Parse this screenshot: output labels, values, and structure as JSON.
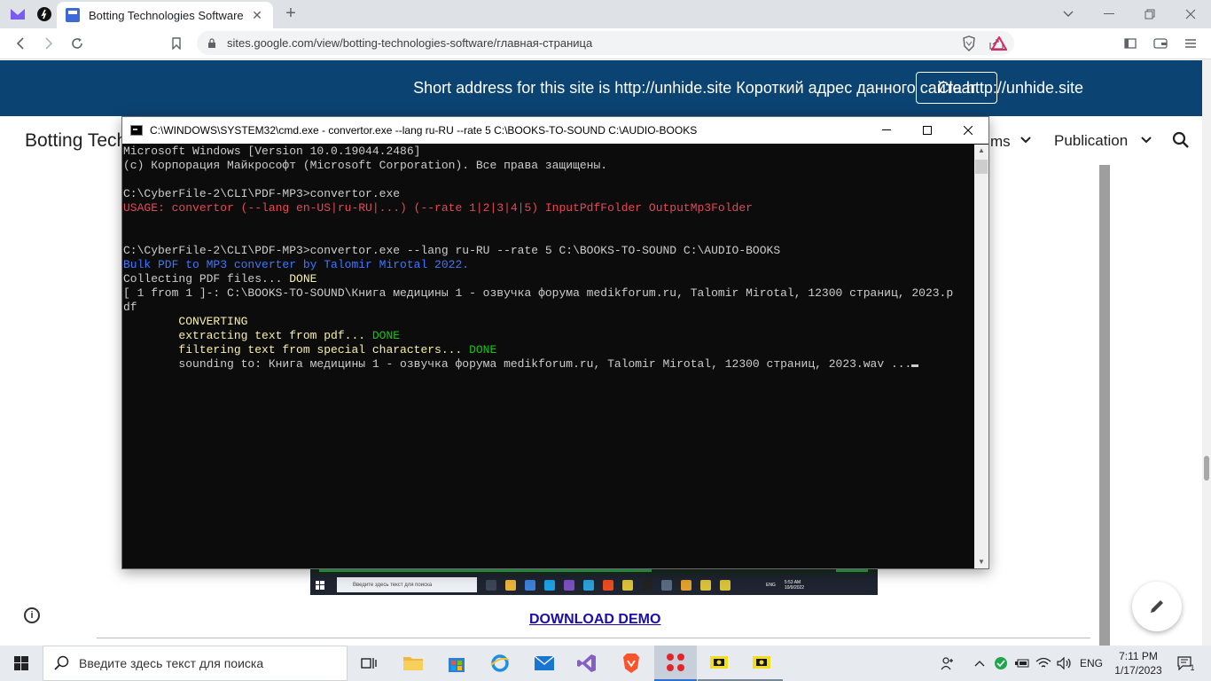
{
  "browser": {
    "tab_title": "Botting Technologies Software",
    "tab_close": "✕",
    "new_tab": "+",
    "url": "sites.google.com/view/botting-technologies-software/главная-страница"
  },
  "banner": {
    "text": "Short address for this site is http://unhide.site Короткий адрес данного сайта http://unhide.site",
    "clear_label": "Clear"
  },
  "site": {
    "title_partial": "Botting Technc",
    "nav_partial": "ms",
    "nav_publication": "Publication",
    "download_demo": "DOWNLOAD DEMO"
  },
  "cmd": {
    "title": "C:\\WINDOWS\\SYSTEM32\\cmd.exe - convertor.exe  --lang ru-RU --rate 5 C:\\BOOKS-TO-SOUND C:\\AUDIO-BOOKS",
    "lines": {
      "l1": "Microsoft Windows [Version 10.0.19044.2486]",
      "l2": "(c) Корпорация Майкрософт (Microsoft Corporation). Все права защищены.",
      "l3": "C:\\CyberFile-2\\CLI\\PDF-MP3>convertor.exe",
      "l4": "USAGE: convertor (--lang en-US|ru-RU|...) (--rate 1|2|3|4|5) InputPdfFolder OutputMp3Folder",
      "l5": "C:\\CyberFile-2\\CLI\\PDF-MP3>convertor.exe --lang ru-RU --rate 5 C:\\BOOKS-TO-SOUND C:\\AUDIO-BOOKS",
      "l6": "Bulk PDF to MP3 converter by Talomir Mirotal 2022.",
      "l7a": "Collecting PDF files... ",
      "l7b": "DONE",
      "l8": "[ 1 from 1 ]-: C:\\BOOKS-TO-SOUND\\Книга медицины 1 - озвучка форума medikforum.ru, Talomir Mirotal, 12300 страниц, 2023.p",
      "l9": "df",
      "l10": "        CONVERTING",
      "l11a": "        extracting text from pdf... ",
      "l11b": "DONE",
      "l12a": "        filtering text from special characters... ",
      "l12b": "DONE",
      "l13": "        sounding to: Книга медицины 1 - озвучка форума medikforum.ru, Talomir Mirotal, 12300 страниц, 2023.wav ..."
    }
  },
  "mini_taskbar": {
    "search_placeholder": "Введите здесь текст для поиска",
    "lang": "ENG",
    "time": "5:53 AM",
    "date": "10/9/2022"
  },
  "taskbar": {
    "search_placeholder": "Введите здесь текст для поиска",
    "lang": "ENG",
    "time": "7:11 PM",
    "date": "1/17/2023",
    "notifications": "1"
  },
  "colors": {
    "banner_bg": "#0b4372",
    "console_bg": "#0c0c0c",
    "console_text": "#cccccc",
    "console_red": "#e74856",
    "console_blue": "#3b78ff",
    "console_yellow": "#f9f1a5",
    "console_green": "#16c60c",
    "link": "#1a0dab"
  }
}
